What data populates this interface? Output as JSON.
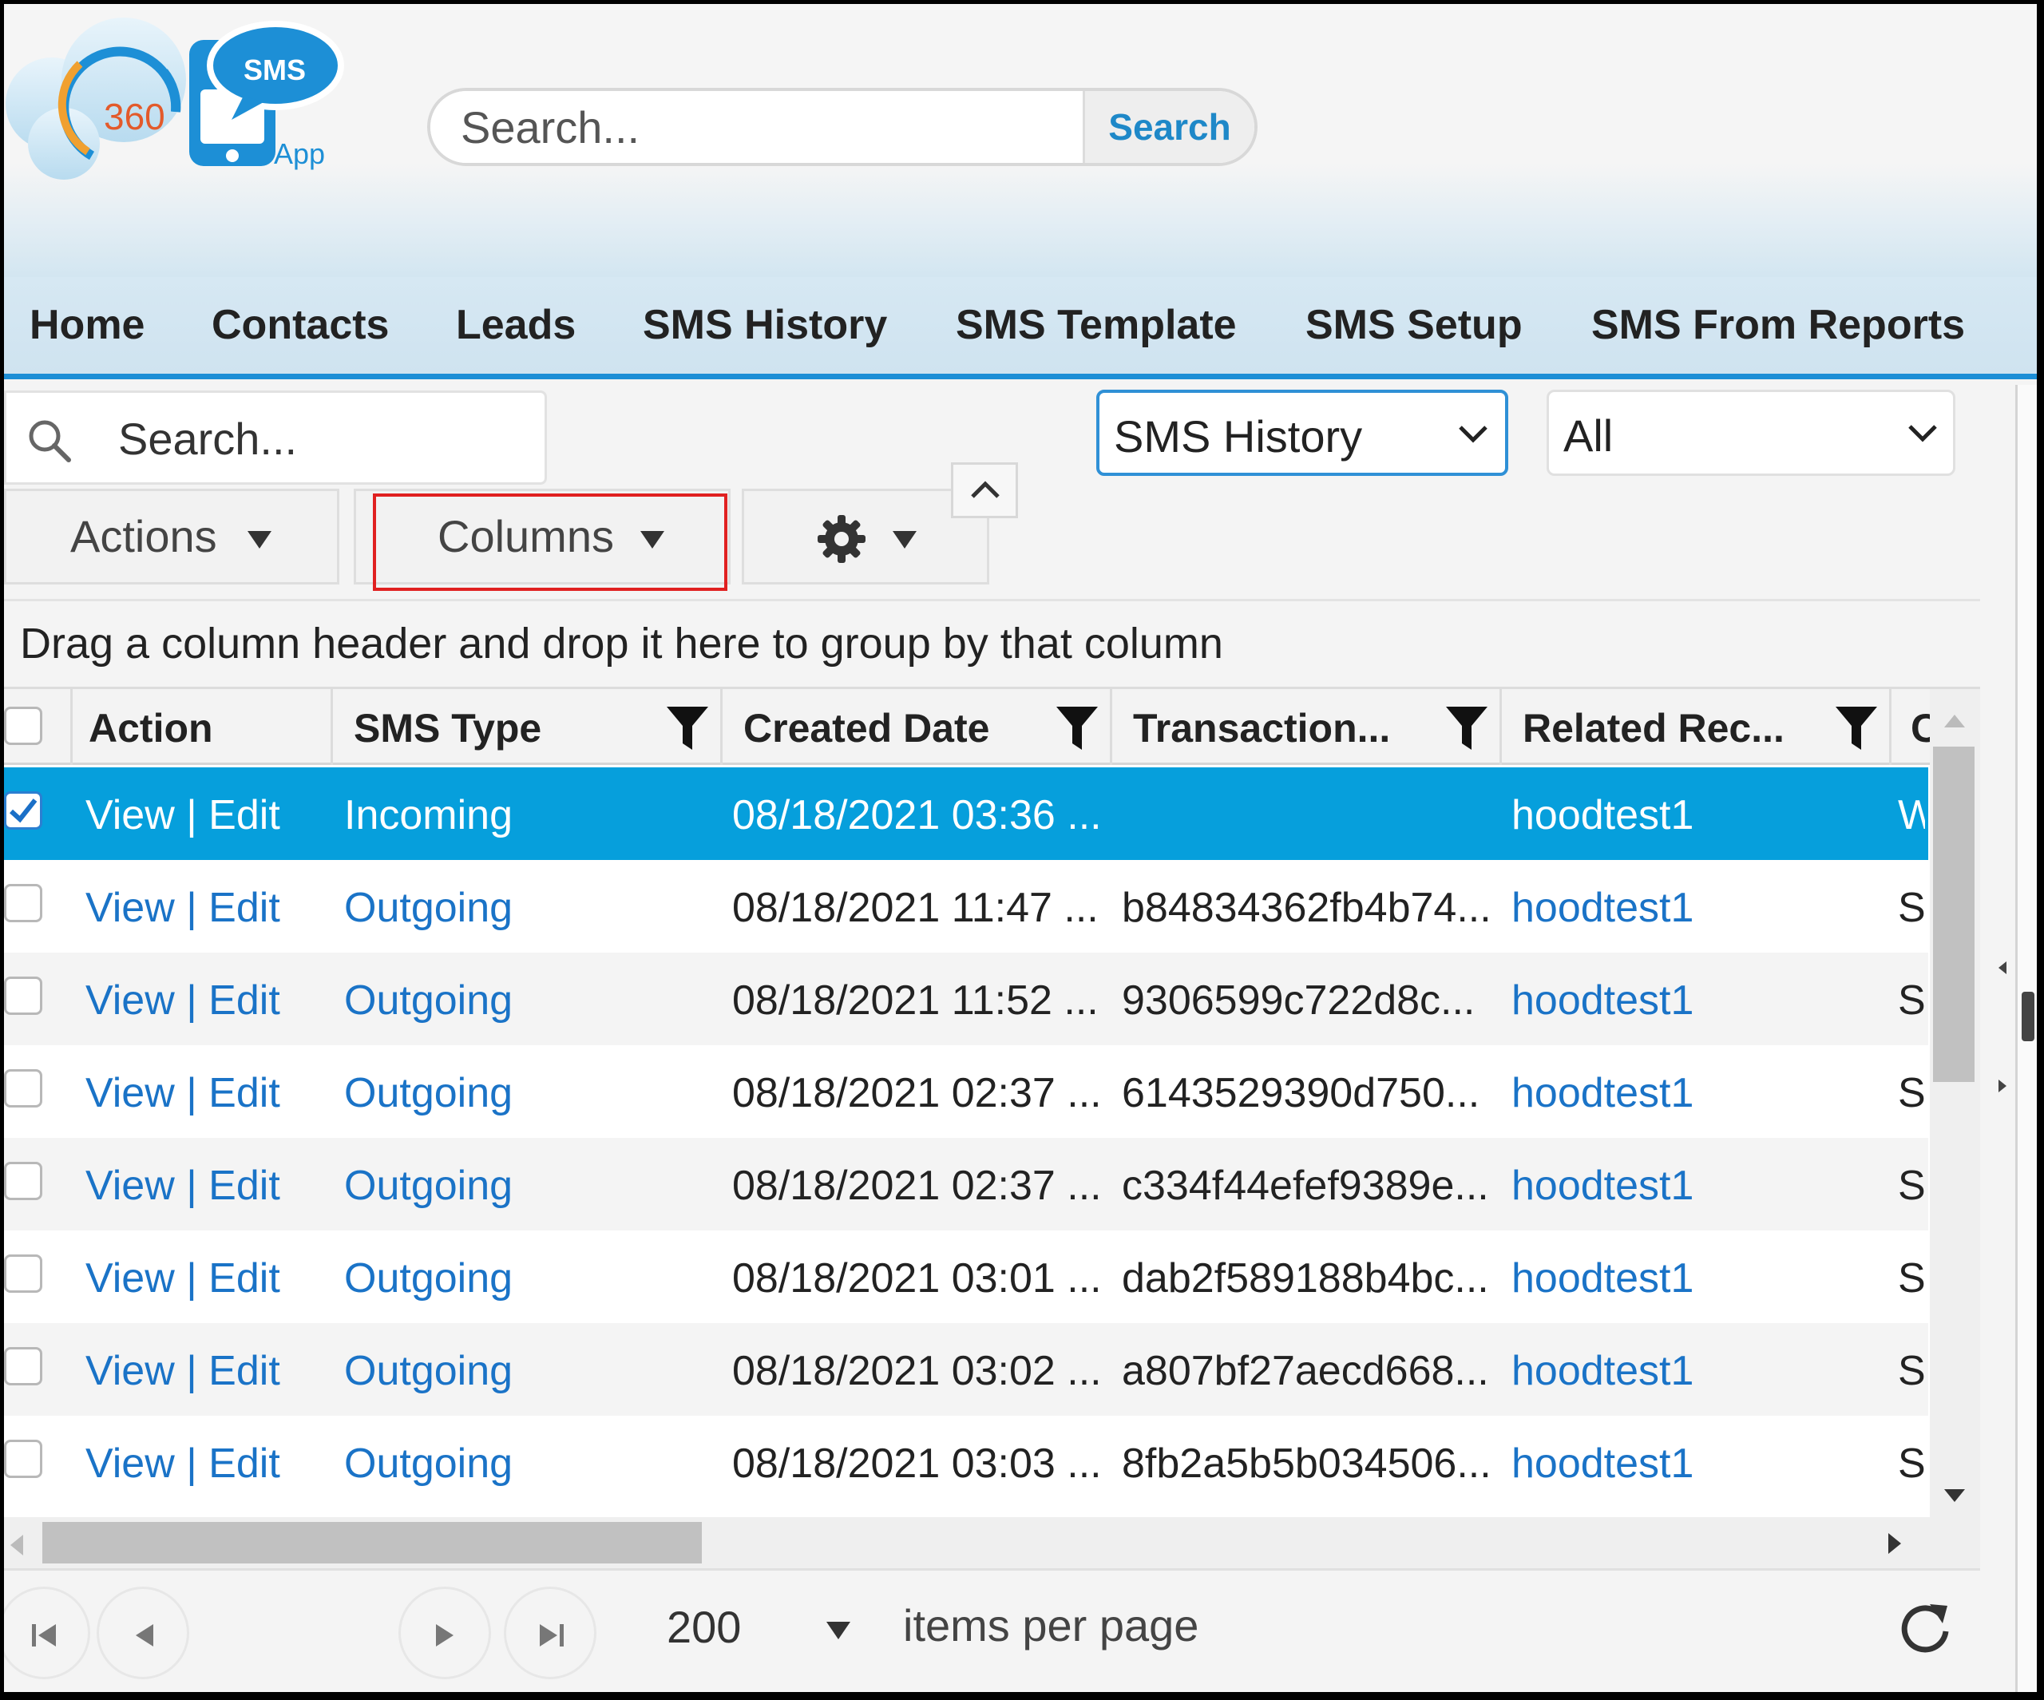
{
  "logo": {
    "badge": "SMS",
    "number": "360",
    "app": "App"
  },
  "top_search": {
    "placeholder": "Search...",
    "button": "Search"
  },
  "nav": [
    "Home",
    "Contacts",
    "Leads",
    "SMS History",
    "SMS Template",
    "SMS Setup",
    "SMS From Reports"
  ],
  "toolbar": {
    "search_placeholder": "Search...",
    "view_select": "SMS History",
    "filter_select": "All",
    "actions": "Actions",
    "columns": "Columns"
  },
  "group_bar": "Drag a column header and drop it here to group by that column",
  "grid": {
    "headers": [
      "Action",
      "SMS Type",
      "Created Date",
      "Transaction...",
      "Related Rec...",
      "C"
    ],
    "rows": [
      {
        "action": "View | Edit",
        "type": "Incoming",
        "date": "08/18/2021 03:36 ...",
        "trans": "",
        "related": "hoodtest1",
        "next": "W",
        "selected": true
      },
      {
        "action": "View | Edit",
        "type": "Outgoing",
        "date": "08/18/2021 11:47 ...",
        "trans": "b84834362fb4b74...",
        "related": "hoodtest1",
        "next": "S"
      },
      {
        "action": "View | Edit",
        "type": "Outgoing",
        "date": "08/18/2021 11:52 ...",
        "trans": "9306599c722d8c...",
        "related": "hoodtest1",
        "next": "S"
      },
      {
        "action": "View | Edit",
        "type": "Outgoing",
        "date": "08/18/2021 02:37 ...",
        "trans": "6143529390d750...",
        "related": "hoodtest1",
        "next": "S"
      },
      {
        "action": "View | Edit",
        "type": "Outgoing",
        "date": "08/18/2021 02:37 ...",
        "trans": "c334f44efef9389e...",
        "related": "hoodtest1",
        "next": "S"
      },
      {
        "action": "View | Edit",
        "type": "Outgoing",
        "date": "08/18/2021 03:01 ...",
        "trans": "dab2f589188b4bc...",
        "related": "hoodtest1",
        "next": "S"
      },
      {
        "action": "View | Edit",
        "type": "Outgoing",
        "date": "08/18/2021 03:02 ...",
        "trans": "a807bf27aecd668...",
        "related": "hoodtest1",
        "next": "S"
      },
      {
        "action": "View | Edit",
        "type": "Outgoing",
        "date": "08/18/2021 03:03 ...",
        "trans": "8fb2a5b5b034506...",
        "related": "hoodtest1",
        "next": "S"
      }
    ]
  },
  "pager": {
    "page_size": "200",
    "label": "items per page"
  },
  "icons": [
    "search-icon",
    "chevron-down-icon",
    "caret-down-icon",
    "gear-icon",
    "chevron-up-icon",
    "filter-icon",
    "checkmark-icon",
    "first-page-icon",
    "prev-page-icon",
    "next-page-icon",
    "last-page-icon",
    "refresh-icon"
  ],
  "colors": {
    "accent": "#1c8ed6",
    "selected_row": "#069fdc",
    "link": "#1a73c7",
    "highlight_box": "#e02020"
  }
}
